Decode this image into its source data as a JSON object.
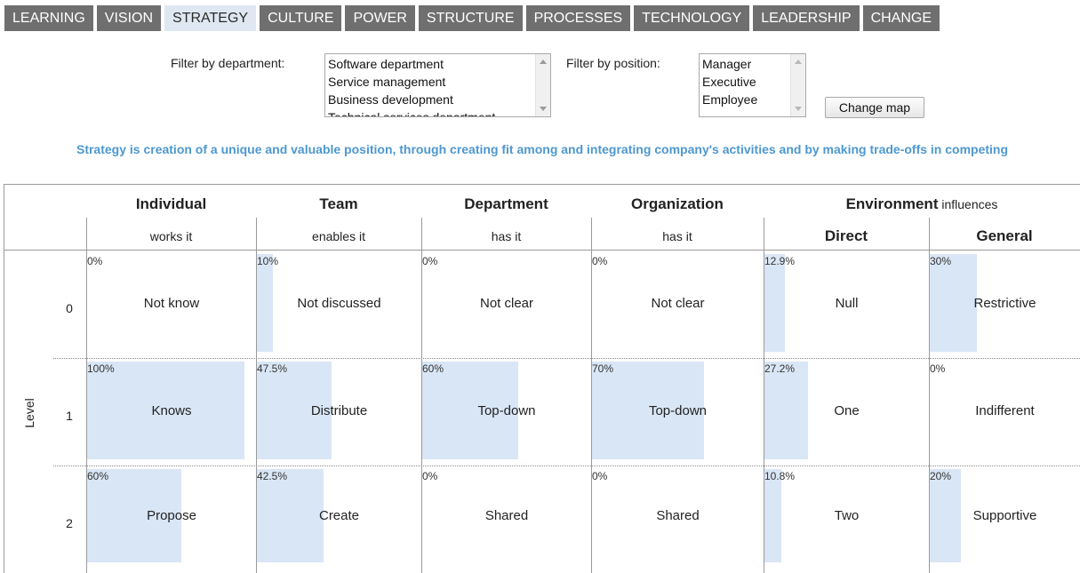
{
  "tabs": [
    {
      "label": "LEARNING"
    },
    {
      "label": "VISION"
    },
    {
      "label": "STRATEGY",
      "active": true
    },
    {
      "label": "CULTURE"
    },
    {
      "label": "POWER"
    },
    {
      "label": "STRUCTURE"
    },
    {
      "label": "PROCESSES"
    },
    {
      "label": "TECHNOLOGY"
    },
    {
      "label": "LEADERSHIP"
    },
    {
      "label": "CHANGE"
    }
  ],
  "filters": {
    "department_label": "Filter by department:",
    "departments": [
      "Software department",
      "Service management",
      "Business development",
      "Technical services department"
    ],
    "position_label": "Filter by position:",
    "positions": [
      "Manager",
      "Executive",
      "Employee"
    ],
    "change_map_label": "Change map"
  },
  "definition": "Strategy is creation of a unique and valuable position, through creating fit among and integrating company's activities and by making trade-offs in competing",
  "map": {
    "columns": {
      "individual": {
        "title": "Individual",
        "sub": "works it"
      },
      "team": {
        "title": "Team",
        "sub": "enables it"
      },
      "department": {
        "title": "Department",
        "sub": "has it"
      },
      "organization": {
        "title": "Organization",
        "sub": "has it"
      },
      "environment": {
        "title": "Environment",
        "suffix": " influences"
      },
      "direct": {
        "sub": "Direct"
      },
      "general": {
        "sub": "General"
      }
    },
    "level_label": "Level",
    "levels": [
      {
        "level": "0",
        "cells": [
          {
            "pct_text": "0%",
            "pct": 0,
            "label": "Not know"
          },
          {
            "pct_text": "10%",
            "pct": 10,
            "label": "Not discussed"
          },
          {
            "pct_text": "0%",
            "pct": 0,
            "label": "Not clear"
          },
          {
            "pct_text": "0%",
            "pct": 0,
            "label": "Not clear"
          },
          {
            "pct_text": "12.9%",
            "pct": 12.9,
            "label": "Null"
          },
          {
            "pct_text": "30%",
            "pct": 30,
            "label": "Restrictive"
          }
        ]
      },
      {
        "level": "1",
        "cells": [
          {
            "pct_text": "100%",
            "pct": 100,
            "label": "Knows"
          },
          {
            "pct_text": "47.5%",
            "pct": 47.5,
            "label": "Distribute"
          },
          {
            "pct_text": "60%",
            "pct": 60,
            "label": "Top-down"
          },
          {
            "pct_text": "70%",
            "pct": 70,
            "label": "Top-down"
          },
          {
            "pct_text": "27.2%",
            "pct": 27.2,
            "label": "One"
          },
          {
            "pct_text": "0%",
            "pct": 0,
            "label": "Indifferent"
          }
        ]
      },
      {
        "level": "2",
        "cells": [
          {
            "pct_text": "60%",
            "pct": 60,
            "label": "Propose"
          },
          {
            "pct_text": "42.5%",
            "pct": 42.5,
            "label": "Create"
          },
          {
            "pct_text": "0%",
            "pct": 0,
            "label": "Shared"
          },
          {
            "pct_text": "0%",
            "pct": 0,
            "label": "Shared"
          },
          {
            "pct_text": "10.8%",
            "pct": 10.8,
            "label": "Two"
          },
          {
            "pct_text": "20%",
            "pct": 20,
            "label": "Supportive"
          }
        ]
      }
    ]
  },
  "colors": {
    "tab_bg": "#6f6f6f",
    "tab_active_bg": "#dfe8f2",
    "definition_text": "#4d98cf",
    "bar_fill": "#d9e6f5"
  }
}
